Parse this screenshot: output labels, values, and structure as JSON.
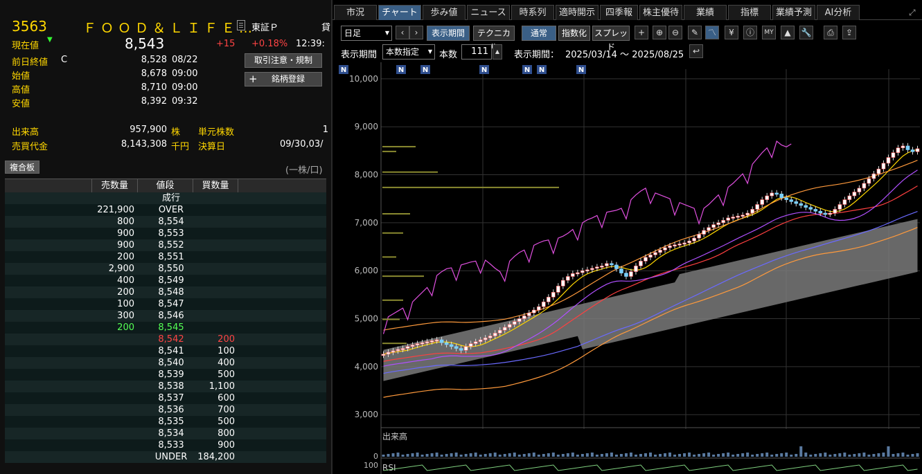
{
  "stock": {
    "code": "3563",
    "name": "ＦＯＯＤ＆ＬＩＦＥ…",
    "market": "東証Ｐ",
    "market_extra": "貸"
  },
  "current": {
    "label": "現在値",
    "price": "8,543",
    "change": "+15",
    "pct": "+0.18%",
    "time": "12:39:"
  },
  "details": [
    {
      "label": "前日終値",
      "flag": "C",
      "value": "8,528",
      "time": "08/22"
    },
    {
      "label": "始値",
      "flag": "",
      "value": "8,678",
      "time": "09:00"
    },
    {
      "label": "高値",
      "flag": "",
      "value": "8,710",
      "time": "09:00"
    },
    {
      "label": "安値",
      "flag": "",
      "value": "8,392",
      "time": "09:32"
    }
  ],
  "volume": {
    "label": "出来高",
    "value": "957,900",
    "unit": "株"
  },
  "turnover": {
    "label": "売買代金",
    "value": "8,143,308",
    "unit": "千円"
  },
  "unit_shares": {
    "label": "単元株数",
    "value": "1"
  },
  "settlement": {
    "label": "決算日",
    "value": "09/30,03/"
  },
  "buttons": {
    "caution": "取引注意・規制",
    "register": "銘柄登録"
  },
  "board": {
    "title": "複合板",
    "unit_note": "(一株/口)",
    "headers": [
      "売数量",
      "値段",
      "買数量"
    ],
    "market_order": "成行",
    "rows": [
      {
        "ask": "221,900",
        "price": "OVER",
        "bid": ""
      },
      {
        "ask": "800",
        "price": "8,554",
        "bid": ""
      },
      {
        "ask": "900",
        "price": "8,553",
        "bid": ""
      },
      {
        "ask": "900",
        "price": "8,552",
        "bid": ""
      },
      {
        "ask": "200",
        "price": "8,551",
        "bid": ""
      },
      {
        "ask": "2,900",
        "price": "8,550",
        "bid": ""
      },
      {
        "ask": "400",
        "price": "8,549",
        "bid": ""
      },
      {
        "ask": "200",
        "price": "8,548",
        "bid": ""
      },
      {
        "ask": "100",
        "price": "8,547",
        "bid": ""
      },
      {
        "ask": "300",
        "price": "8,546",
        "bid": ""
      },
      {
        "ask": "200",
        "price": "8,545",
        "bid": "",
        "hl": "green"
      },
      {
        "ask": "",
        "price": "8,542",
        "bid": "200",
        "hl": "red"
      },
      {
        "ask": "",
        "price": "8,541",
        "bid": "100"
      },
      {
        "ask": "",
        "price": "8,540",
        "bid": "400"
      },
      {
        "ask": "",
        "price": "8,539",
        "bid": "500"
      },
      {
        "ask": "",
        "price": "8,538",
        "bid": "1,100"
      },
      {
        "ask": "",
        "price": "8,537",
        "bid": "600"
      },
      {
        "ask": "",
        "price": "8,536",
        "bid": "700"
      },
      {
        "ask": "",
        "price": "8,535",
        "bid": "500"
      },
      {
        "ask": "",
        "price": "8,534",
        "bid": "800"
      },
      {
        "ask": "",
        "price": "8,533",
        "bid": "900"
      },
      {
        "ask": "",
        "price": "UNDER",
        "bid": "184,200"
      }
    ]
  },
  "tabs": [
    "市況",
    "チャート",
    "歩み値",
    "ニュース",
    "時系列",
    "適時開示",
    "四季報",
    "株主優待",
    "業績",
    "指標",
    "業績予測",
    "AI分析"
  ],
  "toolbar": {
    "period_select": "日足",
    "display_period": "表示期間",
    "technical": "テクニカル",
    "normal": "通常",
    "index": "指数化",
    "spread": "スプレッド"
  },
  "toolbar2": {
    "period_label": "表示期間",
    "period_mode": "本数指定",
    "count_label": "本数",
    "count": "111",
    "range_label": "表示期間：",
    "range": "2025/03/14 ～ 2025/08/25"
  },
  "chart_data": {
    "type": "candlestick",
    "y_ticks": [
      "10,000",
      "9,000",
      "8,000",
      "7,000",
      "6,000",
      "5,000",
      "4,000",
      "3,000"
    ],
    "ylim": [
      2700,
      10200
    ],
    "news_marker": "N",
    "volume_label": "出来高",
    "volume_zero": "0",
    "rsi_label": "RSI",
    "rsi_top": "100",
    "close": [
      4260,
      4300,
      4330,
      4360,
      4380,
      4420,
      4450,
      4480,
      4500,
      4520,
      4540,
      4560,
      4500,
      4460,
      4420,
      4380,
      4340,
      4420,
      4480,
      4520,
      4560,
      4600,
      4640,
      4700,
      4760,
      4820,
      4880,
      4940,
      5000,
      5060,
      5120,
      5180,
      5250,
      5350,
      5450,
      5550,
      5680,
      5800,
      5880,
      5940,
      5960,
      6000,
      6020,
      6050,
      6080,
      6100,
      6150,
      6120,
      6040,
      5950,
      5880,
      5980,
      6100,
      6200,
      6280,
      6330,
      6380,
      6430,
      6480,
      6520,
      6540,
      6560,
      6580,
      6620,
      6680,
      6760,
      6840,
      6900,
      6960,
      7000,
      7050,
      7100,
      7120,
      7140,
      7160,
      7200,
      7280,
      7380,
      7480,
      7560,
      7620,
      7600,
      7520,
      7480,
      7440,
      7400,
      7360,
      7320,
      7280,
      7240,
      7200,
      7180,
      7200,
      7280,
      7380,
      7480,
      7560,
      7640,
      7720,
      7820,
      7920,
      8020,
      8120,
      8240,
      8360,
      8460,
      8560,
      8600,
      8520,
      8480,
      8543
    ]
  }
}
